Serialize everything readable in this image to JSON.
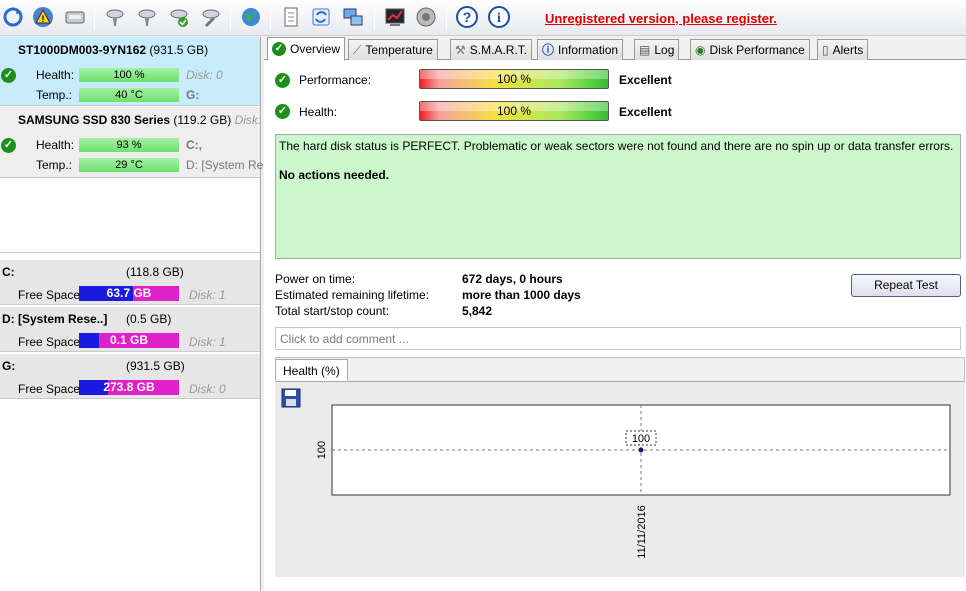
{
  "toolbar": {
    "icons": [
      "refresh-icon",
      "alert-icon",
      "disk-icon",
      "disk-tool-1-icon",
      "disk-tool-2-icon",
      "disk-check-icon",
      "disk-wrench-icon",
      "globe-icon",
      "document-icon",
      "sync-icon",
      "network-icon",
      "chart-icon",
      "speaker-icon",
      "help-icon",
      "info-icon"
    ],
    "register_text": "Unregistered version, please register."
  },
  "disks": [
    {
      "model": "ST1000DM003-9YN162",
      "size": "(931.5 GB)",
      "health_label": "Health:",
      "health_value": "100 %",
      "health_fraction": 1.0,
      "temp_label": "Temp.:",
      "temp_value": "40 °C",
      "disk_ref": "Disk: 0",
      "drive_letter": "G:"
    },
    {
      "model": "SAMSUNG SSD 830 Series",
      "size": "(119.2 GB)",
      "disk_ref": "Disk:",
      "health_label": "Health:",
      "health_value": "93 %",
      "health_fraction": 0.93,
      "temp_label": "Temp.:",
      "temp_value": "29 °C",
      "drive_letter_1": "C:,",
      "drive_letter_2": "D: [System Re"
    }
  ],
  "volumes": [
    {
      "name": "C:",
      "size": "(118.8 GB)",
      "free_label": "Free Space",
      "free_value": "63.7 GB",
      "free_fraction": 0.536,
      "disk": "Disk: 1"
    },
    {
      "name": "D: [System Rese..]",
      "size": "(0.5 GB)",
      "free_label": "Free Space",
      "free_value": "0.1 GB",
      "free_fraction": 0.2,
      "disk": "Disk: 1"
    },
    {
      "name": "G:",
      "size": "(931.5 GB)",
      "free_label": "Free Space",
      "free_value": "273.8 GB",
      "free_fraction": 0.294,
      "disk": "Disk: 0"
    }
  ],
  "tabs": [
    "Overview",
    "Temperature",
    "S.M.A.R.T.",
    "Information",
    "Log",
    "Disk Performance",
    "Alerts"
  ],
  "overview": {
    "performance_label": "Performance:",
    "performance_value": "100 %",
    "performance_rating": "Excellent",
    "health_label": "Health:",
    "health_value": "100 %",
    "health_rating": "Excellent",
    "status_text": "The hard disk status is PERFECT. Problematic or weak sectors were not found and there are no spin up or data transfer errors.",
    "status_action": "No actions needed.",
    "power_on_label": "Power on time:",
    "power_on_value": "672 days, 0 hours",
    "lifetime_label": "Estimated remaining lifetime:",
    "lifetime_value": "more than 1000 days",
    "startstop_label": "Total start/stop count:",
    "startstop_value": "5,842",
    "repeat_button": "Repeat Test",
    "comment_placeholder": "Click to add comment ..."
  },
  "chart_tab_label": "Health (%)",
  "chart_data": {
    "type": "line",
    "x": [
      "11/11/2016"
    ],
    "series": [
      {
        "values": [
          100
        ]
      }
    ],
    "ytick": "100",
    "data_label": "100"
  },
  "colors": {
    "register_red": "#e00000",
    "status_green": "#ccf7cc",
    "free_blue": "#1a1ae0",
    "free_magenta": "#e020c8"
  }
}
